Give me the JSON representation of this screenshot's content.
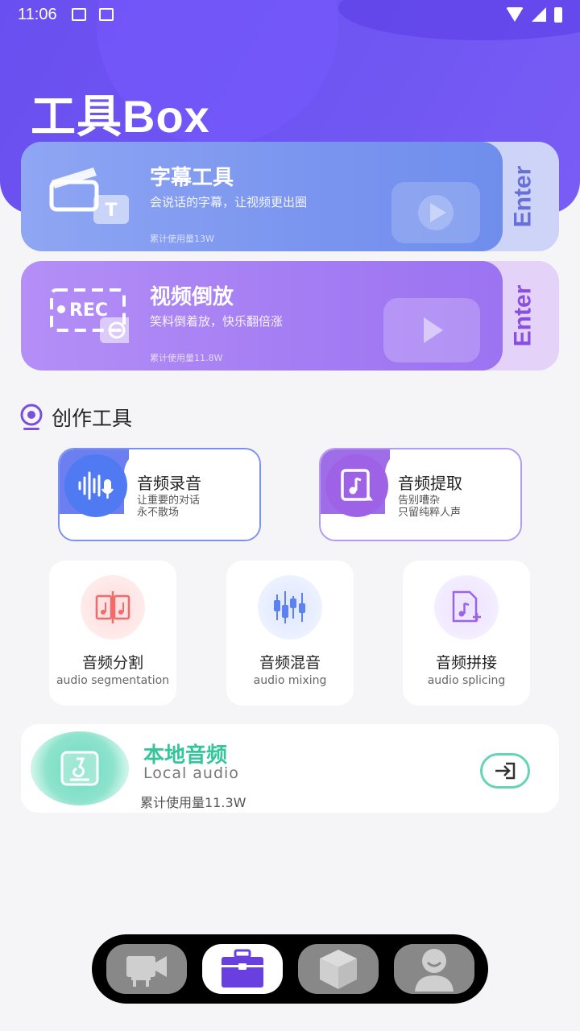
{
  "status_bar": {
    "time": "11:06"
  },
  "app": {
    "title": "工具Box"
  },
  "feature_cards": [
    {
      "title": "字幕工具",
      "desc": "会说话的字幕，让视频更出圈",
      "usage": "累计使用量13W",
      "enter": "Enter",
      "icon": "clapperboard-icon"
    },
    {
      "title": "视频倒放",
      "desc": "笑料倒着放，快乐翻倍涨",
      "usage": "累计使用量11.8W",
      "enter": "Enter",
      "icon": "rec-rewind-icon"
    }
  ],
  "section": {
    "title": "创作工具"
  },
  "highlight_tools": [
    {
      "title": "音频录音",
      "desc_line1": "让重要的对话",
      "desc_line2": "永不散场",
      "icon": "waveform-mic-icon"
    },
    {
      "title": "音频提取",
      "desc_line1": "告别嘈杂",
      "desc_line2": "只留纯粹人声",
      "icon": "music-file-extract-icon"
    }
  ],
  "mini_tools": [
    {
      "title": "音频分割",
      "subtitle": "audio segmentation",
      "icon": "split-audio-icon",
      "color": "#f26b6b"
    },
    {
      "title": "音频混音",
      "subtitle": "audio mixing",
      "icon": "mixer-icon",
      "color": "#5b82f0"
    },
    {
      "title": "音频拼接",
      "subtitle": "audio splicing",
      "icon": "music-file-add-icon",
      "color": "#9b63e6"
    }
  ],
  "local_audio": {
    "title": "本地音频",
    "subtitle": "Local audio",
    "usage": "累计使用量11.3W",
    "icon": "local-music-icon"
  },
  "bottom_nav": [
    {
      "name": "video-camera-icon",
      "active": false
    },
    {
      "name": "toolbox-icon",
      "active": true
    },
    {
      "name": "cube-icon",
      "active": false
    },
    {
      "name": "profile-icon",
      "active": false
    }
  ],
  "colors": {
    "primary": "#6f56f2",
    "teal": "#34c59b",
    "blue": "#4f7af1",
    "violet": "#9d62e6"
  }
}
